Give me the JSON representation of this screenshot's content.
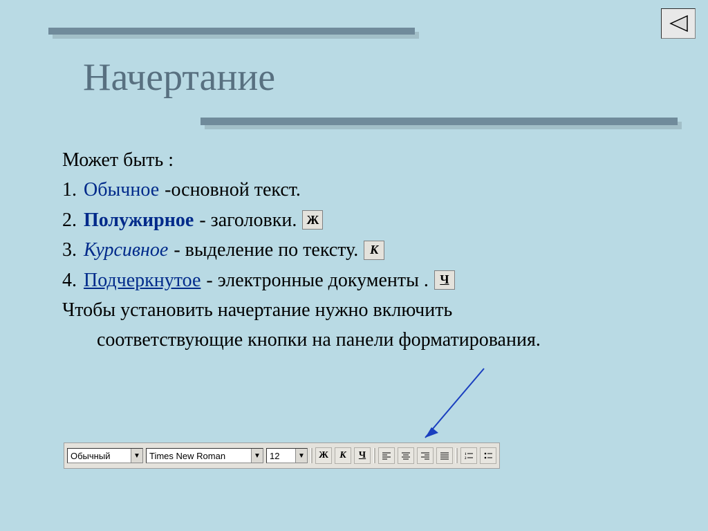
{
  "title": "Начертание",
  "nav_back_icon": "◁",
  "content": {
    "intro": "Может быть :",
    "items": [
      {
        "num": "1.",
        "keyword": "Обычное",
        "desc": "-основной текст.",
        "btn": null
      },
      {
        "num": "2.",
        "keyword": "Полужирное",
        "desc": "- заголовки.",
        "btn": "Ж"
      },
      {
        "num": "3.",
        "keyword": "Курсивное",
        "desc": "- выделение по тексту.",
        "btn": "К"
      },
      {
        "num": "4.",
        "keyword": "Подчеркнутое",
        "desc": "- электронные документы .",
        "btn": "Ч"
      }
    ],
    "outro_line1": "Чтобы установить начертание нужно включить",
    "outro_line2": "соответствующие кнопки на панели форматирования."
  },
  "toolbar": {
    "style": "Обычный",
    "font": "Times New Roman",
    "size": "12",
    "bold": "Ж",
    "italic": "К",
    "underline": "Ч"
  }
}
